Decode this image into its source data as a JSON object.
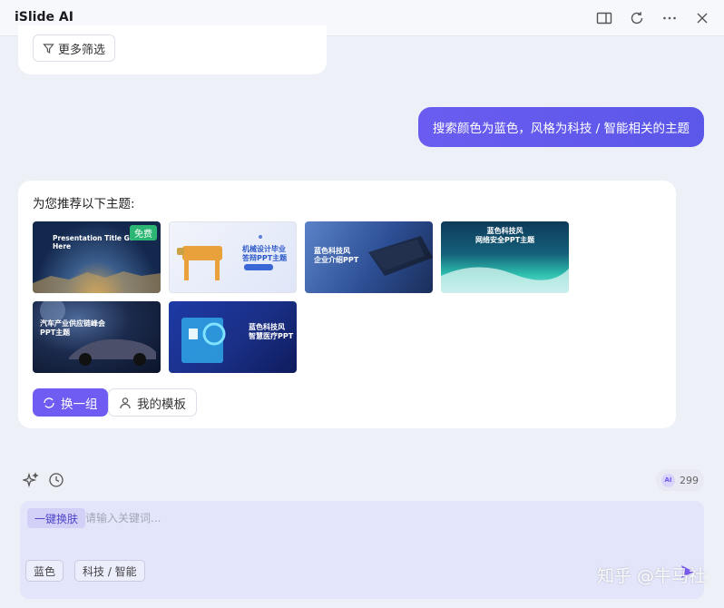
{
  "titlebar": {
    "title": "iSlide AI",
    "icons": [
      "panel-toggle-icon",
      "refresh-icon",
      "more-icon",
      "close-icon"
    ]
  },
  "top_card": {
    "filter_label": "更多筛选"
  },
  "user_message": "搜索颜色为蓝色，风格为科技 / 智能相关的主题",
  "result": {
    "intro": "为您推荐以下主题:",
    "themes": [
      {
        "text": "Presentation Title Goes Here",
        "badge": "免费"
      },
      {
        "text": "机械设计毕业\n答辩PPT主题"
      },
      {
        "text": "蓝色科技风\n企业介绍PPT"
      },
      {
        "text": "蓝色科技风\n网络安全PPT主题"
      },
      {
        "text": "汽车产业供应链峰会\nPPT主题"
      },
      {
        "text": "蓝色科技风\n智慧医疗PPT"
      }
    ],
    "refresh_label": "换一组",
    "my_templates_label": "我的模板"
  },
  "toolbar": {
    "credit_ai": "AI",
    "credit_value": "299"
  },
  "input": {
    "skin_tag": "一键换肤",
    "placeholder": "请输入关键词...",
    "chips": [
      "蓝色",
      "科技 / 智能"
    ]
  },
  "watermark": "知乎 @牛马社",
  "colors": {
    "accent": "#6a5cf0",
    "background": "#eef0f7",
    "input_panel": "#e3e5fa",
    "free_badge": "#2bb673"
  }
}
